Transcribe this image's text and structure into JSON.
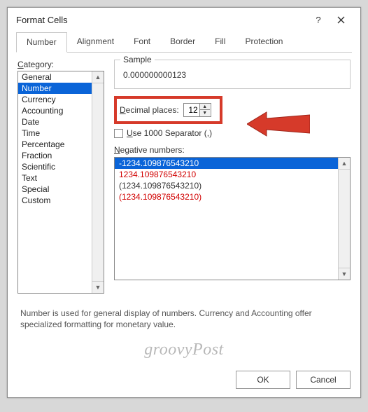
{
  "title": "Format Cells",
  "tabs": [
    "Number",
    "Alignment",
    "Font",
    "Border",
    "Fill",
    "Protection"
  ],
  "active_tab": 0,
  "category_label": "Category:",
  "categories": [
    "General",
    "Number",
    "Currency",
    "Accounting",
    "Date",
    "Time",
    "Percentage",
    "Fraction",
    "Scientific",
    "Text",
    "Special",
    "Custom"
  ],
  "category_selected": 1,
  "sample_label": "Sample",
  "sample_value": "0.000000000123",
  "decimal_label": "Decimal places:",
  "decimal_value": "12",
  "separator_label": "Use 1000 Separator (,)",
  "negative_label": "Negative numbers:",
  "negative_formats": [
    {
      "text": "-1234.109876543210",
      "red": false,
      "selected": true
    },
    {
      "text": "1234.109876543210",
      "red": true,
      "selected": false
    },
    {
      "text": "(1234.109876543210)",
      "red": false,
      "selected": false
    },
    {
      "text": "(1234.109876543210)",
      "red": true,
      "selected": false
    }
  ],
  "description": "Number is used for general display of numbers.  Currency and Accounting offer specialized formatting for monetary value.",
  "ok_label": "OK",
  "cancel_label": "Cancel",
  "watermark": "groovyPost"
}
